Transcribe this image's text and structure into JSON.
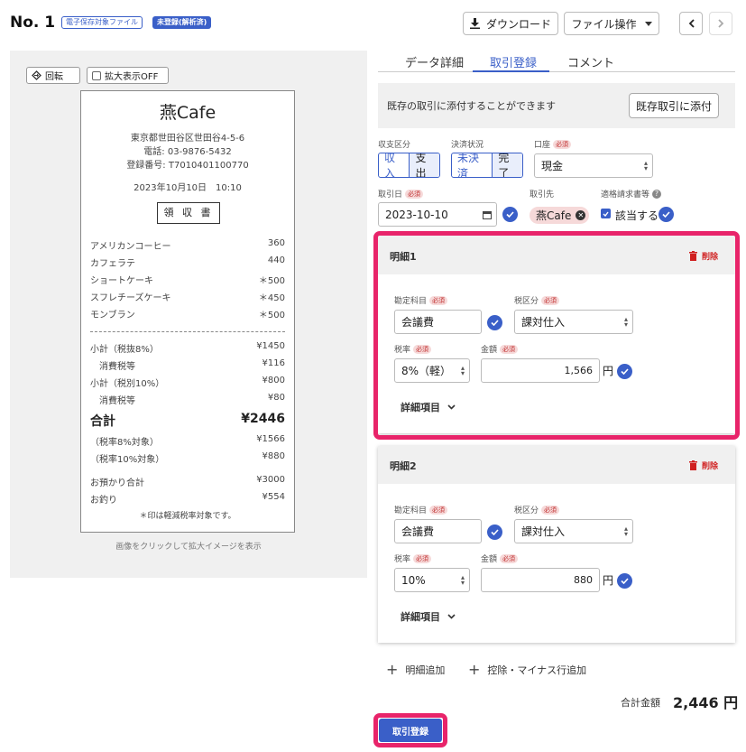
{
  "header": {
    "doc_no": "No. 1",
    "badge_archive": "電子保存対象ファイル",
    "badge_status": "未登録(解析済)",
    "download_label": "ダウンロード",
    "file_ops_label": "ファイル操作"
  },
  "viewer": {
    "rotate_label": "回転",
    "zoom_label": "拡大表示OFF",
    "caption": "画像をクリックして拡大イメージを表示"
  },
  "receipt": {
    "shop": "燕Cafe",
    "address": "東京都世田谷区世田谷4-5-6",
    "phone": "電話: 03-9876-5432",
    "reg_no": "登録番号: T7010401100770",
    "datetime": "2023年10月10日　10:10",
    "doc_title": "領 収 書",
    "items": [
      {
        "name": "アメリカンコーヒー",
        "price": "360"
      },
      {
        "name": "カフェラテ",
        "price": "440"
      },
      {
        "name": "ショートケーキ",
        "price": "＊500"
      },
      {
        "name": "スフレチーズケーキ",
        "price": "＊450"
      },
      {
        "name": "モンブラン",
        "price": "＊500"
      }
    ],
    "subtotal8_label": "小計（税抜8%）",
    "subtotal8": "¥1450",
    "tax8_label": "消費税等",
    "tax8": "¥116",
    "subtotal10_label": "小計（税別10%）",
    "subtotal10": "¥800",
    "tax10_label": "消費税等",
    "tax10": "¥80",
    "total_label": "合計",
    "total": "¥2446",
    "target8_label": "（税率8%対象）",
    "target8": "¥1566",
    "target10_label": "（税率10%対象）",
    "target10": "¥880",
    "received_label": "お預かり合計",
    "received": "¥3000",
    "change_label": "お釣り",
    "change": "¥554",
    "note": "＊印は軽減税率対象です。"
  },
  "tabs": [
    "データ詳細",
    "取引登録",
    "コメント"
  ],
  "notice": {
    "text": "既存の取引に添付することができます",
    "button": "既存取引に添付"
  },
  "form": {
    "required": "必須",
    "income_type_label": "収支区分",
    "income": "収入",
    "expense": "支出",
    "settle_label": "決済状況",
    "unsettled": "未決済",
    "settled": "完了",
    "account_label": "口座",
    "account_value": "現金",
    "date_label": "取引日",
    "date_value": "2023-10-10",
    "partner_label": "取引先",
    "partner_value": "燕Cafe",
    "invoice_label": "適格請求書等",
    "invoice_check": "該当する"
  },
  "details": [
    {
      "title": "明細1",
      "delete": "削除",
      "account_label": "勘定科目",
      "account": "会議費",
      "taxcat_label": "税区分",
      "taxcat": "課対仕入",
      "rate_label": "税率",
      "rate": "8%（軽）",
      "amount_label": "金額",
      "amount": "1,566",
      "yen": "円",
      "more": "詳細項目"
    },
    {
      "title": "明細2",
      "delete": "削除",
      "account_label": "勘定科目",
      "account": "会議費",
      "taxcat_label": "税区分",
      "taxcat": "課対仕入",
      "rate_label": "税率",
      "rate": "10%",
      "amount_label": "金額",
      "amount": "880",
      "yen": "円",
      "more": "詳細項目"
    }
  ],
  "footer": {
    "add_detail": "明細追加",
    "add_deduct": "控除・マイナス行追加",
    "total_label": "合計金額",
    "total_value": "2,446 円",
    "submit": "取引登録"
  },
  "colors": {
    "accent": "#3a5fc8",
    "highlight": "#e8246a",
    "danger": "#d02020",
    "required_bg": "#f6d9d9"
  }
}
